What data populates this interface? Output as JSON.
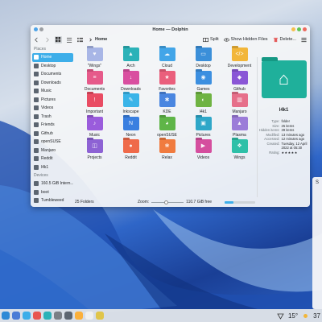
{
  "window": {
    "title": "Home — Dolphin"
  },
  "toolbar": {
    "crumb": "Home",
    "split_label": "Split",
    "hidden_label": "Show Hidden Files",
    "delete_label": "Delete..."
  },
  "sidebar": {
    "places_heading": "Places",
    "places": [
      {
        "label": "Home",
        "color": "#3daee9",
        "active": true
      },
      {
        "label": "Desktop",
        "color": "#5c6570"
      },
      {
        "label": "Documents",
        "color": "#5c6570"
      },
      {
        "label": "Downloads",
        "color": "#5c6570"
      },
      {
        "label": "Music",
        "color": "#5c6570"
      },
      {
        "label": "Pictures",
        "color": "#5c6570"
      },
      {
        "label": "Videos",
        "color": "#5c6570"
      },
      {
        "label": "Trash",
        "color": "#5c6570"
      },
      {
        "label": "Friends",
        "color": "#5c6570"
      },
      {
        "label": "Github",
        "color": "#5c6570"
      },
      {
        "label": "openSUSE",
        "color": "#5c6570"
      },
      {
        "label": "Manjaro",
        "color": "#5c6570"
      },
      {
        "label": "Reddit",
        "color": "#5c6570"
      },
      {
        "label": "l4k1",
        "color": "#5c6570"
      }
    ],
    "devices_heading": "Devices",
    "devices": [
      {
        "label": "160.5 GiB Intern...",
        "color": "#5c6570"
      },
      {
        "label": "boot",
        "color": "#5c6570"
      },
      {
        "label": "Tumbleweed",
        "color": "#5c6570"
      }
    ]
  },
  "folders": [
    {
      "label": "\"Wings\"",
      "color": "#a8b6e6",
      "glyph": "♥"
    },
    {
      "label": "Arch",
      "color": "#2bb2b8",
      "glyph": "▲"
    },
    {
      "label": "Cloud",
      "color": "#42a5e8",
      "glyph": "☁"
    },
    {
      "label": "Desktop",
      "color": "#3b8fd9",
      "glyph": "▭"
    },
    {
      "label": "Development",
      "color": "#f2b63a",
      "glyph": "</>"
    },
    {
      "label": "Documents",
      "color": "#e65a8a",
      "glyph": "≡"
    },
    {
      "label": "Downloads",
      "color": "#d94fa0",
      "glyph": "↓"
    },
    {
      "label": "Favorites",
      "color": "#ea5f7c",
      "glyph": "★"
    },
    {
      "label": "Games",
      "color": "#3c8fe0",
      "glyph": "◉"
    },
    {
      "label": "Github",
      "color": "#8a56d6",
      "glyph": "◆"
    },
    {
      "label": "Important",
      "color": "#e94c63",
      "glyph": "!"
    },
    {
      "label": "Inkscape",
      "color": "#3ab4e8",
      "glyph": "✎"
    },
    {
      "label": "KDE",
      "color": "#4a86e0",
      "glyph": "✱"
    },
    {
      "label": "l4k1",
      "color": "#6fb342",
      "glyph": "◐"
    },
    {
      "label": "Manjaro",
      "color": "#e66f8a",
      "glyph": "▥"
    },
    {
      "label": "Music",
      "color": "#9a5cdc",
      "glyph": "♪"
    },
    {
      "label": "Neon",
      "color": "#3a7fe0",
      "glyph": "N"
    },
    {
      "label": "openSUSE",
      "color": "#5fb548",
      "glyph": "◕"
    },
    {
      "label": "Pictures",
      "color": "#2fa7c8",
      "glyph": "▣"
    },
    {
      "label": "Plasma",
      "color": "#9b7cd8",
      "glyph": "▲"
    },
    {
      "label": "Projects",
      "color": "#8d62d4",
      "glyph": "◫"
    },
    {
      "label": "Reddit",
      "color": "#ef6a4a",
      "glyph": "●"
    },
    {
      "label": "Relax",
      "color": "#f07b3f",
      "glyph": "❀"
    },
    {
      "label": "Videos",
      "color": "#d54e9e",
      "glyph": "▶"
    },
    {
      "label": "Wings",
      "color": "#2ec0a8",
      "glyph": "❖"
    }
  ],
  "status": {
    "count": "25 Folders",
    "zoom_label": "Zoom:",
    "zoom_level": 0.45,
    "free": "110.7 GiB free",
    "used_fraction": 0.3
  },
  "info": {
    "name": "l4k1",
    "props": [
      {
        "k": "Type:",
        "v": "folder"
      },
      {
        "k": "Size:",
        "v": "25 items"
      },
      {
        "k": "Hidden items:",
        "v": "39 items"
      },
      {
        "k": "Modified:",
        "v": "13 minutes ago"
      },
      {
        "k": "Accessed:",
        "v": "12 minutes ago"
      },
      {
        "k": "Created:",
        "v": "Tuesday, 12 April 2022 at 05:30"
      },
      {
        "k": "Rating:",
        "v": "★★★★★"
      }
    ],
    "folder_color": "#1fb09b"
  },
  "taskbar": {
    "apps": [
      "#2d89d6",
      "#4a7bd6",
      "#3daee9",
      "#e8554e",
      "#2bb2b8",
      "#7a7f85",
      "#5c6570",
      "#fbb03b",
      "#f0f0f0",
      "#e0c54a"
    ],
    "temperature": "15°",
    "clock_partial": "37"
  },
  "widget": {
    "letter": "S"
  }
}
